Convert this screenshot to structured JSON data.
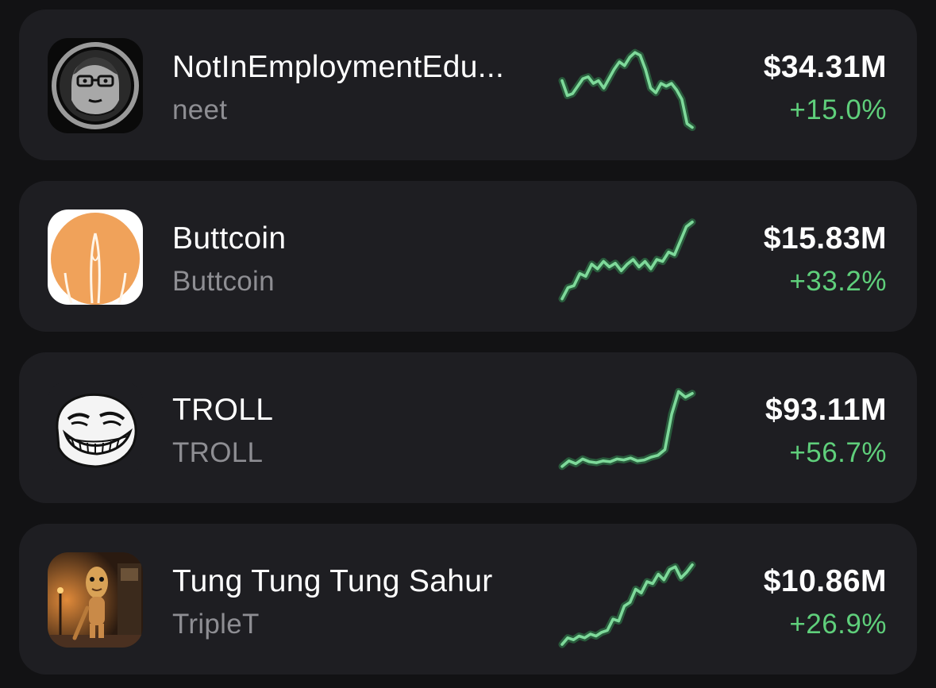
{
  "tokens": [
    {
      "name": "NotInEmploymentEdu...",
      "ticker": "neet",
      "price": "$34.31M",
      "change": "+15.0%",
      "logo": "neet-cartoon-face-logo",
      "sparkline": [
        58,
        42,
        44,
        52,
        60,
        62,
        55,
        58,
        50,
        60,
        70,
        78,
        74,
        83,
        88,
        85,
        70,
        50,
        45,
        55,
        52,
        55,
        48,
        38,
        12,
        8
      ]
    },
    {
      "name": "Buttcoin",
      "ticker": "Buttcoin",
      "price": "$15.83M",
      "change": "+33.2%",
      "logo": "orange-peach-logo",
      "sparkline": [
        8,
        20,
        22,
        35,
        32,
        45,
        40,
        48,
        42,
        46,
        38,
        45,
        50,
        42,
        48,
        40,
        50,
        48,
        58,
        55,
        70,
        85,
        90
      ]
    },
    {
      "name": "TROLL",
      "ticker": "TROLL",
      "price": "$93.11M",
      "change": "+56.7%",
      "logo": "troll-face-logo",
      "sparkline": [
        12,
        18,
        15,
        20,
        17,
        16,
        18,
        17,
        20,
        19,
        21,
        18,
        19,
        22,
        24,
        30,
        68,
        92,
        86,
        90
      ]
    },
    {
      "name": "Tung Tung Tung Sahur",
      "ticker": "TripleT",
      "price": "$10.86M",
      "change": "+26.9%",
      "logo": "tung-sahur-figure-logo",
      "sparkline": [
        5,
        12,
        10,
        14,
        12,
        16,
        14,
        18,
        20,
        32,
        30,
        46,
        50,
        64,
        60,
        72,
        70,
        80,
        74,
        85,
        88,
        76,
        82,
        90
      ]
    }
  ],
  "colors": {
    "background": "#121214",
    "card": "#1e1e22",
    "name": "#ffffff",
    "ticker": "#8e8e93",
    "change_positive": "#5fcf7b",
    "sparkline": "#7ed99a"
  }
}
